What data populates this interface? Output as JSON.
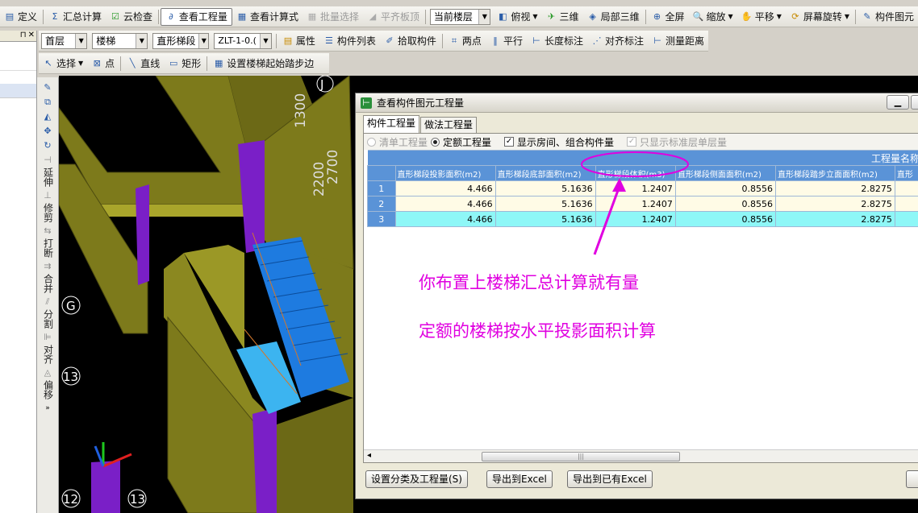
{
  "toolbar1": {
    "items": [
      {
        "label": "定义",
        "icon": "define-icon"
      },
      {
        "label": "汇总计算",
        "icon": "sigma-icon"
      },
      {
        "label": "云检查",
        "icon": "cloud-check-icon"
      },
      {
        "label": "查看工程量",
        "icon": "view-quantity-icon"
      },
      {
        "label": "查看计算式",
        "icon": "formula-icon"
      },
      {
        "label": "批量选择",
        "icon": "batch-select-icon"
      },
      {
        "label": "平齐板顶",
        "icon": "align-slab-icon"
      }
    ],
    "floor_combo": "当前楼层",
    "view_items": [
      {
        "label": "俯视",
        "icon": "top-view-icon"
      },
      {
        "label": "三维",
        "icon": "3d-icon"
      },
      {
        "label": "局部三维",
        "icon": "local-3d-icon"
      },
      {
        "label": "全屏",
        "icon": "fullscreen-icon"
      },
      {
        "label": "缩放",
        "icon": "zoom-icon"
      },
      {
        "label": "平移",
        "icon": "pan-icon"
      },
      {
        "label": "屏幕旋转",
        "icon": "rotate-icon"
      },
      {
        "label": "构件图元",
        "icon": "component-icon"
      }
    ]
  },
  "toolbar2": {
    "floor": "首层",
    "category": "楼梯",
    "type": "直形梯段",
    "component": "ZLT-1-0.(",
    "items": [
      {
        "label": "属性",
        "icon": "property-icon"
      },
      {
        "label": "构件列表",
        "icon": "list-icon"
      },
      {
        "label": "拾取构件",
        "icon": "pick-icon"
      },
      {
        "label": "两点",
        "icon": "two-point-icon"
      },
      {
        "label": "平行",
        "icon": "parallel-icon"
      },
      {
        "label": "长度标注",
        "icon": "length-dim-icon"
      },
      {
        "label": "对齐标注",
        "icon": "align-dim-icon"
      },
      {
        "label": "测量距离",
        "icon": "measure-icon"
      }
    ]
  },
  "toolbar3": {
    "items": [
      {
        "label": "选择",
        "icon": "select-icon"
      },
      {
        "label": "点",
        "icon": "point-icon"
      },
      {
        "label": "直线",
        "icon": "line-icon"
      },
      {
        "label": "矩形",
        "icon": "rect-icon"
      },
      {
        "label": "设置楼梯起始踏步边",
        "icon": "stair-step-icon"
      }
    ]
  },
  "left_tools": [
    "延伸",
    "修剪",
    "打断",
    "合并",
    "分割",
    "对齐",
    "偏移"
  ],
  "viewport": {
    "axis_labels": [
      "J",
      "G",
      "13",
      "12",
      "13"
    ],
    "dimensions": [
      "1300",
      "2700",
      "2200"
    ]
  },
  "dialog": {
    "title": "查看构件图元工程量",
    "tabs": [
      "构件工程量",
      "做法工程量"
    ],
    "options": {
      "qingdan": "清单工程量",
      "dinge": "定额工程量",
      "show_rooms": "显示房间、组合构件量",
      "standard_floor": "只显示标准层单层量"
    },
    "group_header": "工程量名称",
    "columns": [
      "直形梯段投影面积(m2)",
      "直形梯段底部面积(m2)",
      "直形梯段体积(m3)",
      "直形梯段侧面面积(m2)",
      "直形梯段踏步立面面积(m2)",
      "直形"
    ],
    "rows": [
      {
        "num": "1",
        "values": [
          "4.466",
          "5.1636",
          "1.2407",
          "0.8556",
          "2.8275"
        ]
      },
      {
        "num": "2",
        "values": [
          "4.466",
          "5.1636",
          "1.2407",
          "0.8556",
          "2.8275"
        ]
      },
      {
        "num": "3",
        "values": [
          "4.466",
          "5.1636",
          "1.2407",
          "0.8556",
          "2.8275"
        ]
      }
    ],
    "annotations": [
      "你布置上楼梯汇总计算就有量",
      "定额的楼梯按水平投影面积计算"
    ],
    "buttons": [
      "设置分类及工程量(S)",
      "导出到Excel",
      "导出到已有Excel"
    ]
  },
  "colors": {
    "annotation": "#e000e0",
    "header_blue": "#5a93d7",
    "selected_row": "#8ef7f7"
  }
}
